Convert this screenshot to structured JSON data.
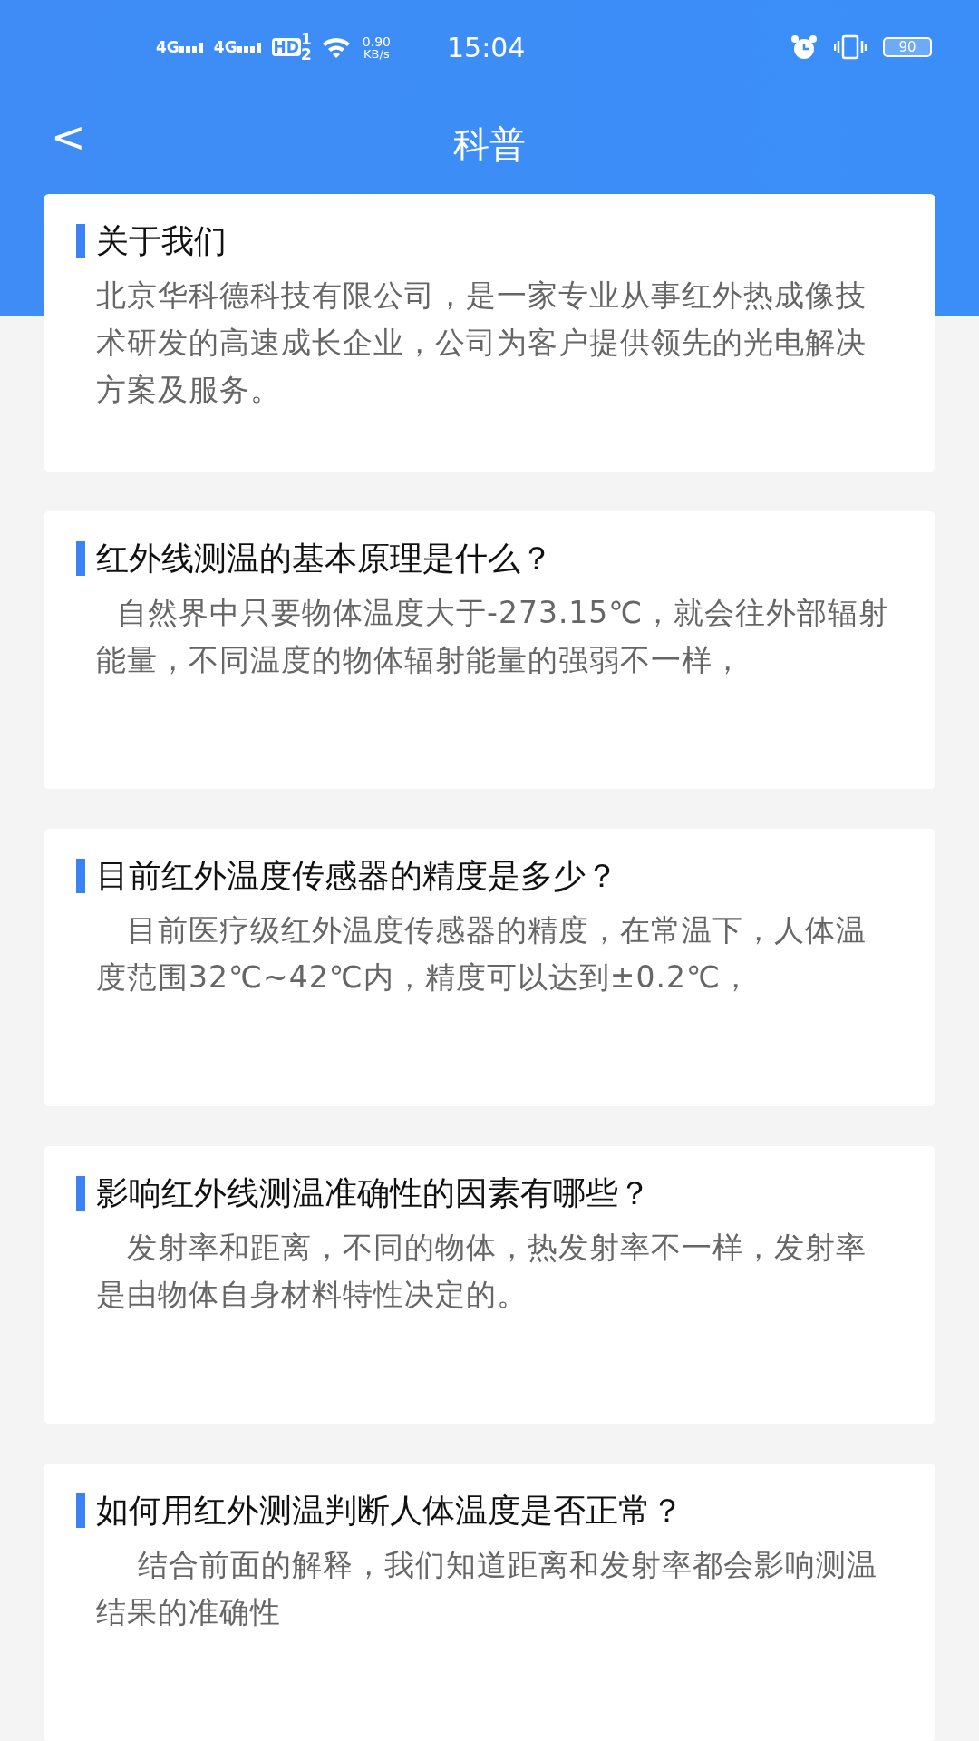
{
  "status_bar": {
    "signal_1": "4G",
    "signal_2": "4G",
    "hd": "HD",
    "hd_sub_1": "1",
    "hd_sub_2": "2",
    "speed_value": "0.90",
    "speed_unit": "KB/s",
    "time": "15:04",
    "battery": "90"
  },
  "header": {
    "back": "<",
    "title": "科普"
  },
  "cards": [
    {
      "title": "关于我们",
      "body": "北京华科德科技有限公司，是一家专业从事红外热成像技术研发的高速成长企业，公司为客户提供领先的光电解决方案及服务。"
    },
    {
      "title": "红外线测温的基本原理是什么？",
      "body": "  自然界中只要物体温度大于-273.15℃，就会往外部辐射能量，不同温度的物体辐射能量的强弱不一样，"
    },
    {
      "title": "目前红外温度传感器的精度是多少？",
      "body": "   目前医疗级红外温度传感器的精度，在常温下，人体温度范围32℃~42℃内，精度可以达到±0.2℃，"
    },
    {
      "title": "影响红外线测温准确性的因素有哪些？",
      "body": "   发射率和距离，不同的物体，热发射率不一样，发射率是由物体自身材料特性决定的。"
    },
    {
      "title": "如何用红外测温判断人体温度是否正常？",
      "body": "    结合前面的解释，我们知道距离和发射率都会影响测温结果的准确性"
    }
  ]
}
